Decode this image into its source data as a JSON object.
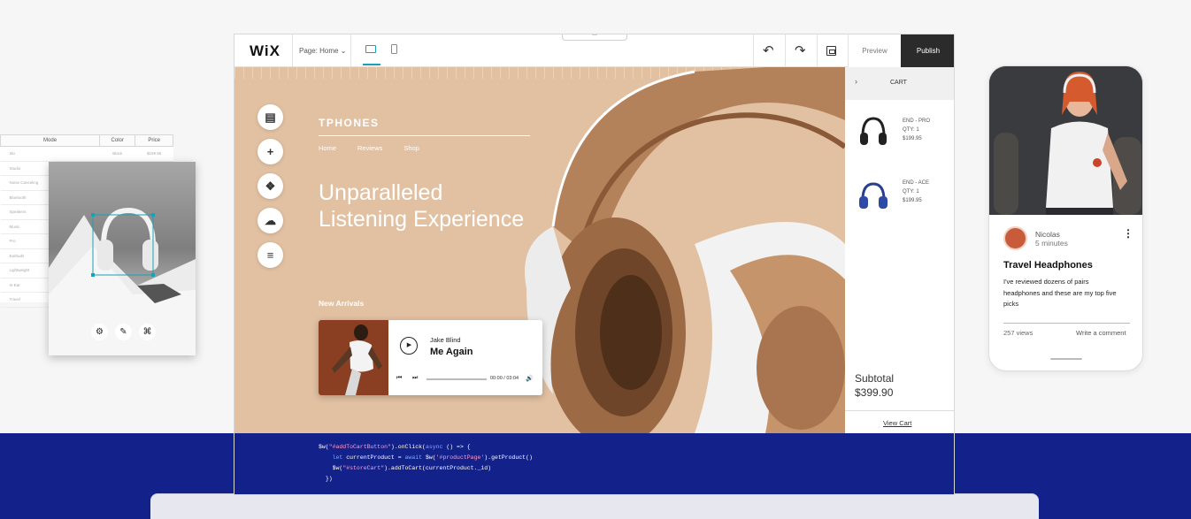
{
  "spreadsheet": {
    "headers": [
      "Mode",
      "Color",
      "Price"
    ],
    "first_row": [
      "Ski",
      "Black",
      "$199.95"
    ],
    "rows": [
      "Studio",
      "Noise Canceling",
      "Bluetooth",
      "Speakers",
      "Music",
      "Pro",
      "Earbuds",
      "Lightweight",
      "In-Ear",
      "Travel"
    ]
  },
  "editor": {
    "logo": "WiX",
    "page_select": "Page: Home ⌄",
    "drag_handle": "—",
    "toolbar": {
      "undo_icon": "↶",
      "redo_icon": "↷",
      "preview_label": "Preview",
      "publish_label": "Publish"
    },
    "site": {
      "brand": "TPHONES",
      "nav": [
        "Home",
        "Reviews",
        "Shop"
      ],
      "headline_line1": "Unparalleled",
      "headline_line2": "Listening Experience",
      "section_label": "New Arrivals"
    },
    "side_tools": [
      {
        "icon": "▤",
        "name": "pages-icon"
      },
      {
        "icon": "+",
        "name": "add-icon"
      },
      {
        "icon": "❖",
        "name": "apps-icon"
      },
      {
        "icon": "☁",
        "name": "upload-icon"
      },
      {
        "icon": "≡",
        "name": "database-icon"
      }
    ],
    "player": {
      "artist": "Jake Blind",
      "song": "Me Again",
      "time": "00:00 / 03:04",
      "progress": 0,
      "play_icon": "▶",
      "prev_icon": "⏮",
      "next_icon": "⏭",
      "volume_icon": "🔊"
    },
    "cart": {
      "title": "CART",
      "chevron": "›",
      "items": [
        {
          "name": "END - PRO",
          "qty": "QTY: 1",
          "price": "$199.95"
        },
        {
          "name": "END - ACE",
          "qty": "QTY: 1",
          "price": "$199.95"
        }
      ],
      "subtotal_label": "Subtotal",
      "subtotal_value": "$399.90",
      "view_cart": "View Cart"
    },
    "code_lines": {
      "l1a": "$w(",
      "l1s": "\"#addToCartButton\"",
      "l1b": ").onClick(",
      "l1k": "async",
      "l1c": " () => {",
      "l2k": "let",
      "l2a": " currentProduct = ",
      "l2k2": "await",
      "l2b": " $w(",
      "l2s": "'#productPage'",
      "l2c": ").getProduct()",
      "l3a": "$w(",
      "l3s": "\"#storeCart\"",
      "l3b": ").addToCart(currentProduct._id)",
      "l4": "})"
    }
  },
  "image_tools": {
    "settings_icon": "⚙",
    "edit_icon": "✎",
    "crop_icon": "⌘"
  },
  "mobile_post": {
    "author": "Nicolas",
    "time": "5 minutes",
    "menu_icon": "⋮",
    "title": "Travel Headphones",
    "body": "I've reviewed dozens of pairs headphones and these are my top five picks",
    "views": "257 views",
    "comment_link": "Write a comment"
  },
  "colors": {
    "accent": "#14a3b8",
    "band": "#13218b",
    "canvas": "#e2c1a2",
    "publish": "#2b2b2b"
  }
}
